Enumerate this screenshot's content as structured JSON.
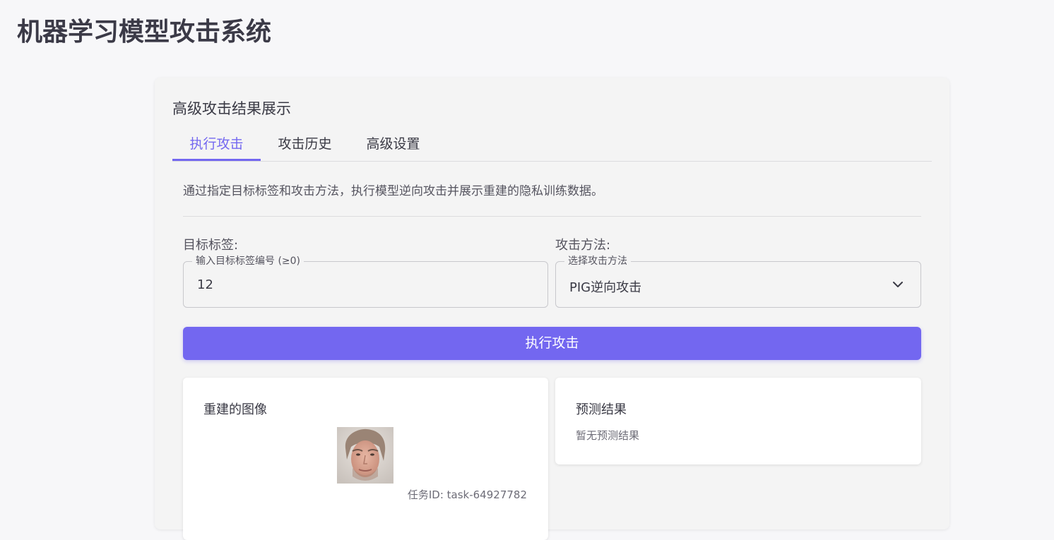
{
  "app": {
    "title": "机器学习模型攻击系统"
  },
  "card": {
    "title": "高级攻击结果展示"
  },
  "tabs": [
    {
      "label": "执行攻击",
      "active": true
    },
    {
      "label": "攻击历史",
      "active": false
    },
    {
      "label": "高级设置",
      "active": false
    }
  ],
  "description": "通过指定目标标签和攻击方法，执行模型逆向攻击并展示重建的隐私训练数据。",
  "form": {
    "target_label": {
      "label": "目标标签:",
      "legend": "输入目标标签编号 (≥0)",
      "value": "12"
    },
    "attack_method": {
      "label": "攻击方法:",
      "legend": "选择攻击方法",
      "value": "PIG逆向攻击",
      "icon": "chevron-down-icon"
    },
    "run_button": "执行攻击"
  },
  "result": {
    "image_card": {
      "title": "重建的图像",
      "task_id": "任务ID: task-64927782"
    },
    "prediction_card": {
      "title": "预测结果",
      "empty_text": "暂无预测结果"
    }
  },
  "colors": {
    "accent": "#7367f0",
    "background": "#f7f7f9",
    "card": "#f4f4f4"
  }
}
